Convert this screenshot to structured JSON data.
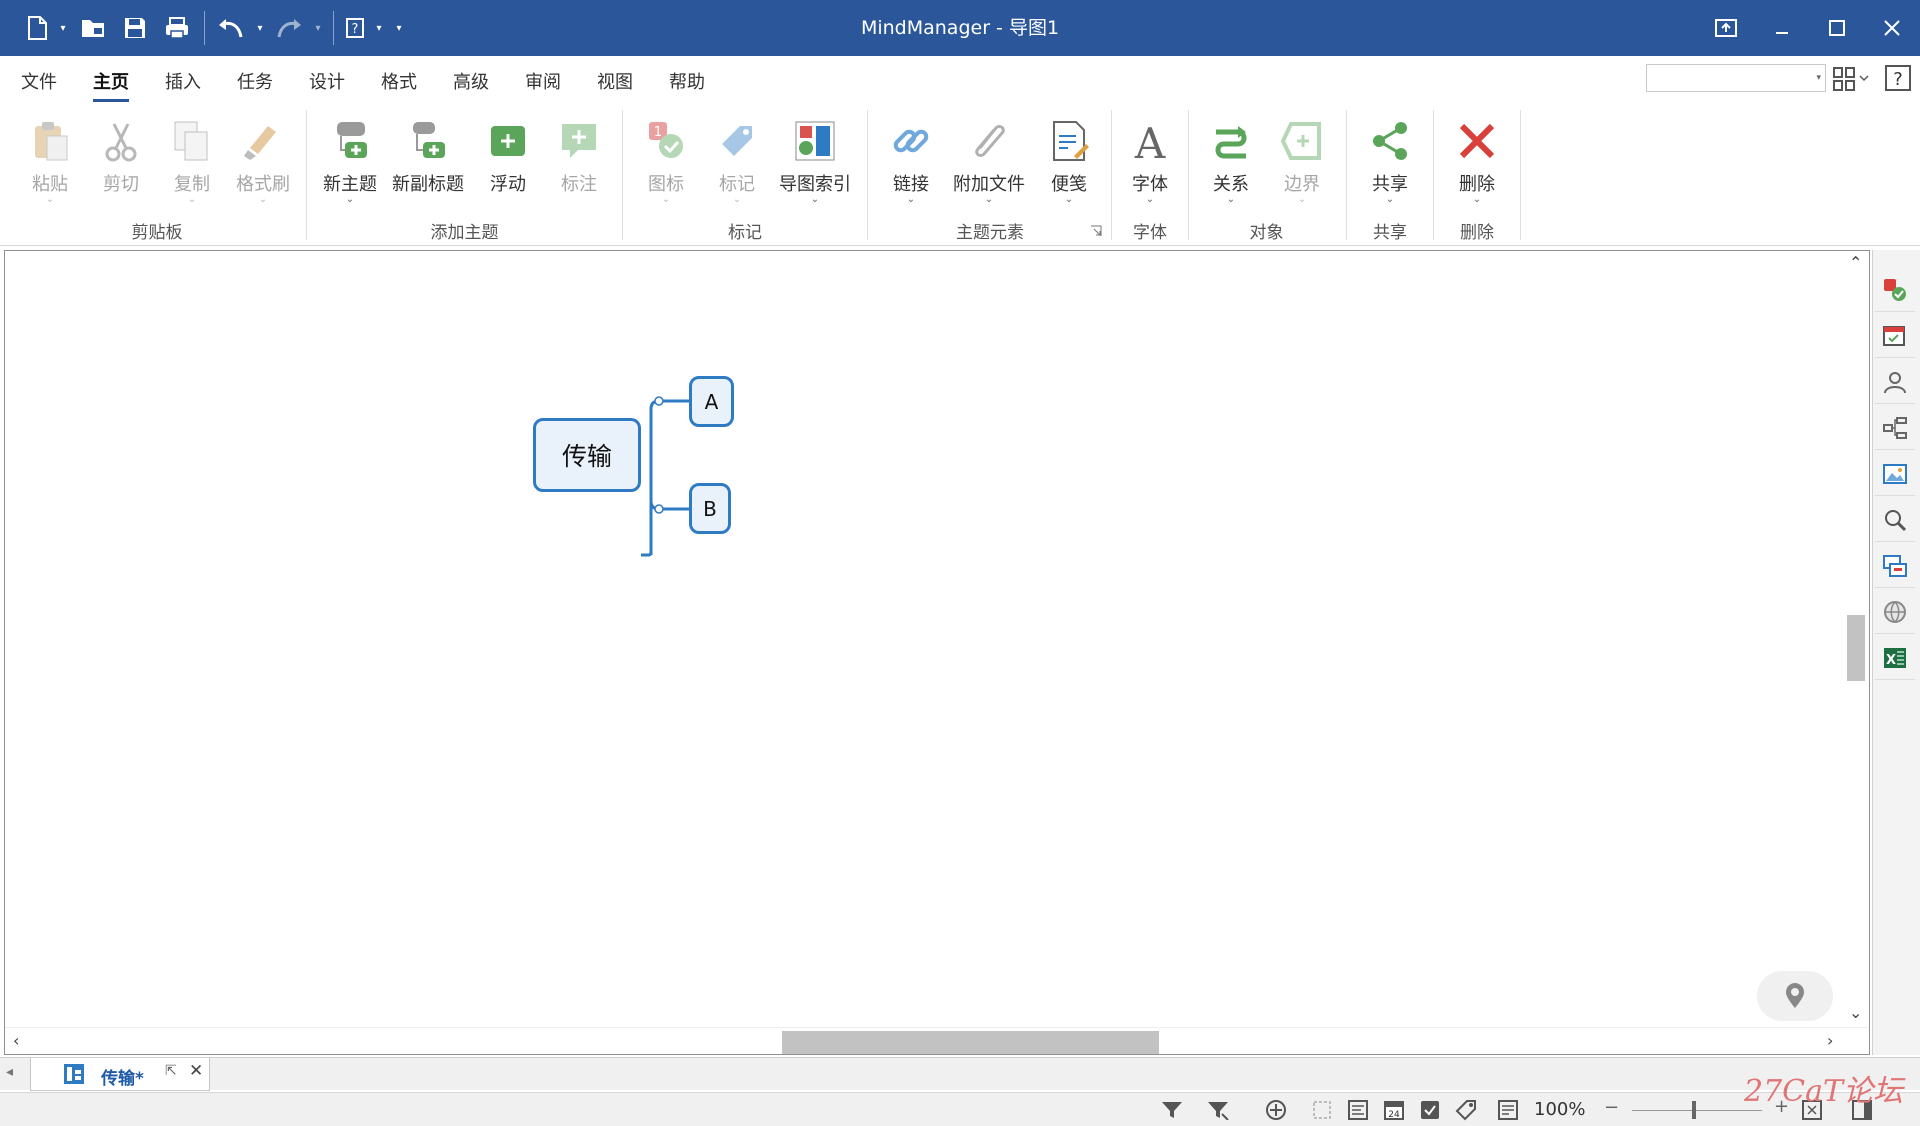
{
  "window": {
    "title": "MindManager - 导图1",
    "title_bar_color": "#2b579a",
    "quick_access": [
      {
        "icon": "new-document-icon"
      },
      {
        "icon": "open-folder-icon"
      },
      {
        "icon": "save-icon"
      },
      {
        "icon": "print-icon"
      },
      {
        "icon": "undo-icon"
      },
      {
        "icon": "redo-icon"
      },
      {
        "icon": "help-icon"
      },
      {
        "icon": "customize-quick-access-icon"
      }
    ],
    "controls": [
      "restore-ribbon-icon",
      "minimize-icon",
      "maximize-icon",
      "close-icon"
    ]
  },
  "menu": {
    "tabs": [
      "文件",
      "主页",
      "插入",
      "任务",
      "设计",
      "格式",
      "高级",
      "审阅",
      "视图",
      "帮助"
    ],
    "active_tab": "主页"
  },
  "ribbon": {
    "groups": [
      {
        "label": "剪贴板",
        "buttons": [
          {
            "label": "粘贴",
            "icon": "paste-icon",
            "enabled": false
          },
          {
            "label": "剪切",
            "icon": "cut-icon",
            "enabled": false
          },
          {
            "label": "复制",
            "icon": "copy-icon",
            "enabled": false
          },
          {
            "label": "格式刷",
            "icon": "format-painter-icon",
            "enabled": false
          }
        ]
      },
      {
        "label": "添加主题",
        "buttons": [
          {
            "label": "新主题",
            "icon": "new-topic-icon",
            "enabled": true
          },
          {
            "label": "新副标题",
            "icon": "new-subtopic-icon",
            "enabled": true
          },
          {
            "label": "浮动",
            "icon": "floating-topic-icon",
            "enabled": true
          },
          {
            "label": "标注",
            "icon": "callout-icon",
            "enabled": false
          }
        ]
      },
      {
        "label": "标记",
        "buttons": [
          {
            "label": "图标",
            "icon": "icons-marker-icon",
            "enabled": false
          },
          {
            "label": "标记",
            "icon": "tag-icon",
            "enabled": false
          },
          {
            "label": "导图索引",
            "icon": "map-index-icon",
            "enabled": true
          }
        ]
      },
      {
        "label": "主题元素",
        "buttons": [
          {
            "label": "链接",
            "icon": "link-icon",
            "enabled": true
          },
          {
            "label": "附加文件",
            "icon": "attachment-icon",
            "enabled": true
          },
          {
            "label": "便笺",
            "icon": "notes-icon",
            "enabled": true
          }
        ]
      },
      {
        "label": "字体",
        "buttons": [
          {
            "label": "字体",
            "icon": "font-icon",
            "enabled": true
          }
        ]
      },
      {
        "label": "对象",
        "buttons": [
          {
            "label": "关系",
            "icon": "relationship-icon",
            "enabled": true
          },
          {
            "label": "边界",
            "icon": "boundary-icon",
            "enabled": false
          }
        ]
      },
      {
        "label": "共享",
        "buttons": [
          {
            "label": "共享",
            "icon": "share-icon",
            "enabled": true
          }
        ]
      },
      {
        "label": "删除",
        "buttons": [
          {
            "label": "删除",
            "icon": "delete-icon",
            "enabled": true
          }
        ]
      }
    ]
  },
  "map": {
    "central_topic": "传输",
    "subtopics": [
      "A",
      "B"
    ],
    "topic_border_color": "#2e7bc4",
    "topic_fill_color": "#e9f1fa"
  },
  "side_panel": [
    "task-info-icon",
    "calendar-icon",
    "resources-icon",
    "map-parts-icon",
    "image-library-icon",
    "search-panel-icon",
    "link-panel-icon",
    "web-icon",
    "excel-icon"
  ],
  "doc_tabs": [
    {
      "label": "传输*"
    }
  ],
  "status": {
    "zoom": "100%",
    "zoom_minus": "−",
    "zoom_plus": "+"
  },
  "watermark": "27CaT论坛"
}
